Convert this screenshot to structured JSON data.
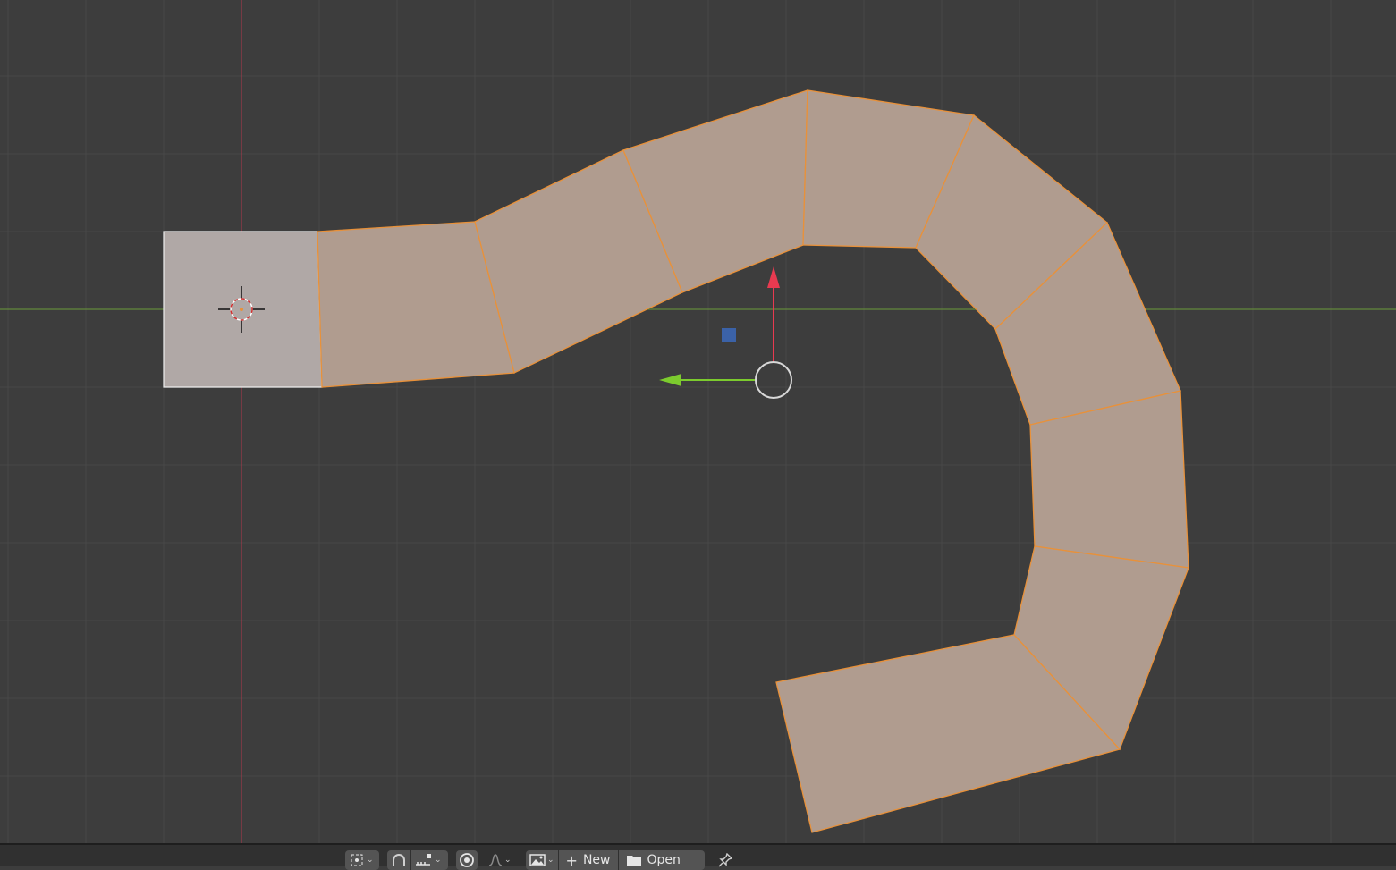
{
  "viewport": {
    "background": "#3d3d3d",
    "grid_color": "#484848",
    "x_axis_color": "#6c9a3a",
    "y_axis_color": "#b0374a",
    "face_color": "#b09c8f",
    "active_face_color": "#b0a8a6",
    "edge_color": "#e8913a",
    "gizmo_up_color": "#e83a50",
    "gizmo_left_color": "#7ccb2e",
    "gizmo_handle_color": "#3b62a8"
  },
  "header": {
    "pivot_icon": "pivot-icon",
    "snap_icon": "snap-magnet-icon",
    "snap_target_icon": "snap-increment-icon",
    "proportional_icon": "proportional-edit-icon",
    "falloff_icon": "falloff-curve-icon",
    "image_icon": "image-browse-icon",
    "new_label": "New",
    "open_label": "Open",
    "pin_icon": "pin-icon"
  }
}
